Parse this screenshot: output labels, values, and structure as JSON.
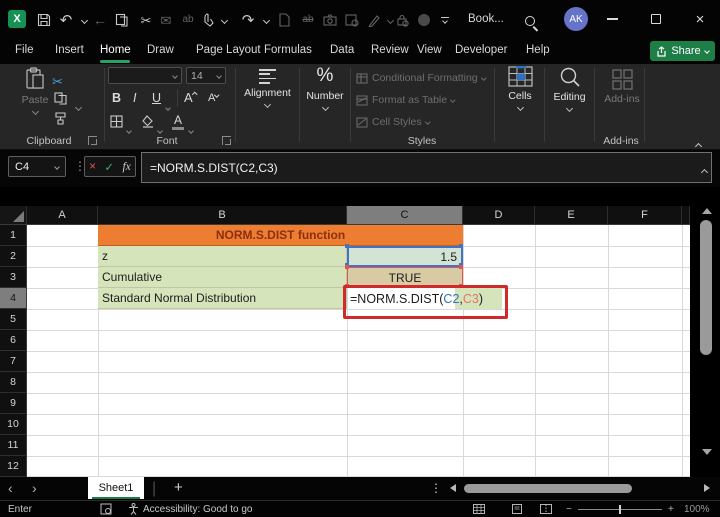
{
  "titlebar": {
    "title": "Book...",
    "avatar": "AK"
  },
  "icons": {
    "logo": "X",
    "undo": "↶",
    "redo": "↷",
    "back": "←",
    "cut": "✂",
    "mail": "✉",
    "replace": "ab",
    "strike": "ab",
    "close": "×",
    "prev_sheet": "‹",
    "next_sheet": "›",
    "dots_v": "⋮",
    "plus": "+",
    "minus": "−",
    "percent": "%",
    "cancel": "×",
    "check": "✓",
    "fx": "fx"
  },
  "menubar": {
    "tabs": [
      "File",
      "Insert",
      "Home",
      "Draw",
      "Page Layout",
      "Formulas",
      "Data",
      "Review",
      "View",
      "Developer",
      "Help"
    ],
    "active_tab": "Home",
    "share_label": "Share"
  },
  "ribbon": {
    "paste_label": "Paste",
    "clipboard_label": "Clipboard",
    "font_group_label": "Font",
    "font_size": "14",
    "bold": "B",
    "italic": "I",
    "underline": "U",
    "grow_font": "A",
    "shrink_font": "A",
    "font_color": "A",
    "alignment_label": "Alignment",
    "number_label": "Number",
    "styles": {
      "items": [
        "Conditional Formatting",
        "Format as Table",
        "Cell Styles"
      ],
      "group_label": "Styles"
    },
    "cells_label": "Cells",
    "editing_label": "Editing",
    "addins_button_label": "Add-ins",
    "addins_group_label": "Add-ins"
  },
  "formula_bar": {
    "name_box": "C4",
    "formula": "=NORM.S.DIST(C2,C3)"
  },
  "grid": {
    "columns": [
      "A",
      "B",
      "C",
      "D",
      "E",
      "F"
    ],
    "rows": [
      "1",
      "2",
      "3",
      "4",
      "5",
      "6",
      "7",
      "8",
      "9",
      "10",
      "11",
      "12"
    ],
    "cells": {
      "title": "NORM.S.DIST function",
      "b2": "z",
      "c2": "1.5",
      "b3": "Cumulative",
      "c3": "TRUE",
      "b4": "Standard Normal Distribution"
    },
    "formula_parts": {
      "prefix": "=NORM.S.DIST(",
      "ref1": "C2",
      "comma": ",",
      "ref2": "C3",
      "suffix": ")"
    }
  },
  "sheet_tabs": {
    "active": "Sheet1"
  },
  "status_bar": {
    "mode": "Enter",
    "accessibility": "Accessibility: Good to go",
    "zoom_level": "100%"
  },
  "colors": {
    "header_fill": "#ED7D31",
    "header_text": "#8C2F10",
    "cell_green": "#D6E4BC",
    "ref_blue": "#2E75B6",
    "ref_red": "#E8736B",
    "annotation_red": "#D02B2B",
    "accent_green": "#21A366"
  }
}
